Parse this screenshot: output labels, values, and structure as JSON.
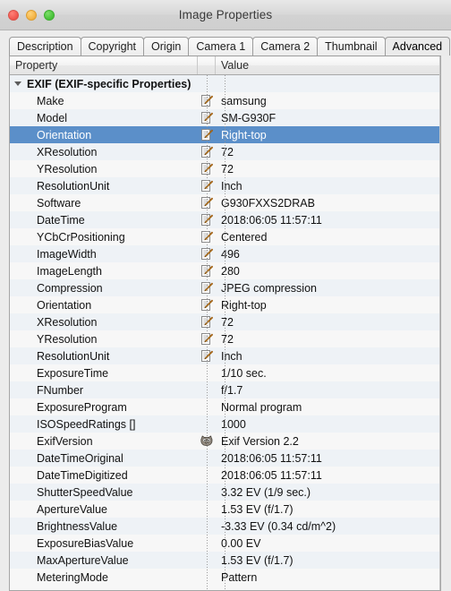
{
  "window": {
    "title": "Image Properties",
    "controls": [
      {
        "name": "close",
        "label": "Close"
      },
      {
        "name": "minimize",
        "label": "Minimize"
      },
      {
        "name": "zoom",
        "label": "Zoom"
      }
    ]
  },
  "tabs": [
    {
      "label": "Description",
      "active": false
    },
    {
      "label": "Copyright",
      "active": false
    },
    {
      "label": "Origin",
      "active": false
    },
    {
      "label": "Camera 1",
      "active": false
    },
    {
      "label": "Camera 2",
      "active": false
    },
    {
      "label": "Thumbnail",
      "active": false
    },
    {
      "label": "Advanced",
      "active": true
    }
  ],
  "table": {
    "columns": [
      "Property",
      "Value"
    ],
    "rows": [
      {
        "property": "EXIF (EXIF-specific Properties)",
        "value": "",
        "icon": "",
        "group": true,
        "selected": false
      },
      {
        "property": "Make",
        "value": "samsung",
        "icon": "pencil",
        "group": false,
        "selected": false
      },
      {
        "property": "Model",
        "value": "SM-G930F",
        "icon": "pencil",
        "group": false,
        "selected": false
      },
      {
        "property": "Orientation",
        "value": "Right-top",
        "icon": "pencil",
        "group": false,
        "selected": true
      },
      {
        "property": "XResolution",
        "value": "72",
        "icon": "pencil",
        "group": false,
        "selected": false
      },
      {
        "property": "YResolution",
        "value": "72",
        "icon": "pencil",
        "group": false,
        "selected": false
      },
      {
        "property": "ResolutionUnit",
        "value": "Inch",
        "icon": "pencil",
        "group": false,
        "selected": false
      },
      {
        "property": "Software",
        "value": "G930FXXS2DRAB",
        "icon": "pencil",
        "group": false,
        "selected": false
      },
      {
        "property": "DateTime",
        "value": "2018:06:05 11:57:11",
        "icon": "pencil",
        "group": false,
        "selected": false
      },
      {
        "property": "YCbCrPositioning",
        "value": "Centered",
        "icon": "pencil",
        "group": false,
        "selected": false
      },
      {
        "property": "ImageWidth",
        "value": "496",
        "icon": "pencil",
        "group": false,
        "selected": false
      },
      {
        "property": "ImageLength",
        "value": "280",
        "icon": "pencil",
        "group": false,
        "selected": false
      },
      {
        "property": "Compression",
        "value": "JPEG compression",
        "icon": "pencil",
        "group": false,
        "selected": false
      },
      {
        "property": "Orientation",
        "value": "Right-top",
        "icon": "pencil",
        "group": false,
        "selected": false
      },
      {
        "property": "XResolution",
        "value": "72",
        "icon": "pencil",
        "group": false,
        "selected": false
      },
      {
        "property": "YResolution",
        "value": "72",
        "icon": "pencil",
        "group": false,
        "selected": false
      },
      {
        "property": "ResolutionUnit",
        "value": "Inch",
        "icon": "pencil",
        "group": false,
        "selected": false
      },
      {
        "property": "ExposureTime",
        "value": "1/10 sec.",
        "icon": "",
        "group": false,
        "selected": false
      },
      {
        "property": "FNumber",
        "value": "f/1.7",
        "icon": "",
        "group": false,
        "selected": false
      },
      {
        "property": "ExposureProgram",
        "value": "Normal program",
        "icon": "",
        "group": false,
        "selected": false
      },
      {
        "property": "ISOSpeedRatings []",
        "value": "1000",
        "icon": "",
        "group": false,
        "selected": false
      },
      {
        "property": "ExifVersion",
        "value": "Exif Version 2.2",
        "icon": "wilber",
        "group": false,
        "selected": false
      },
      {
        "property": "DateTimeOriginal",
        "value": "2018:06:05 11:57:11",
        "icon": "",
        "group": false,
        "selected": false
      },
      {
        "property": "DateTimeDigitized",
        "value": "2018:06:05 11:57:11",
        "icon": "",
        "group": false,
        "selected": false
      },
      {
        "property": "ShutterSpeedValue",
        "value": "3.32 EV (1/9 sec.)",
        "icon": "",
        "group": false,
        "selected": false
      },
      {
        "property": "ApertureValue",
        "value": "1.53 EV (f/1.7)",
        "icon": "",
        "group": false,
        "selected": false
      },
      {
        "property": "BrightnessValue",
        "value": "-3.33 EV (0.34 cd/m^2)",
        "icon": "",
        "group": false,
        "selected": false
      },
      {
        "property": "ExposureBiasValue",
        "value": "0.00 EV",
        "icon": "",
        "group": false,
        "selected": false
      },
      {
        "property": "MaxApertureValue",
        "value": "1.53 EV (f/1.7)",
        "icon": "",
        "group": false,
        "selected": false
      },
      {
        "property": "MeteringMode",
        "value": "Pattern",
        "icon": "",
        "group": false,
        "selected": false
      }
    ]
  },
  "colors": {
    "selection": "#5b8fc9",
    "row_odd": "#eef2f6",
    "row_even": "#f7f7f7",
    "window_bg": "#ececec",
    "pencil": "#f0a030"
  }
}
